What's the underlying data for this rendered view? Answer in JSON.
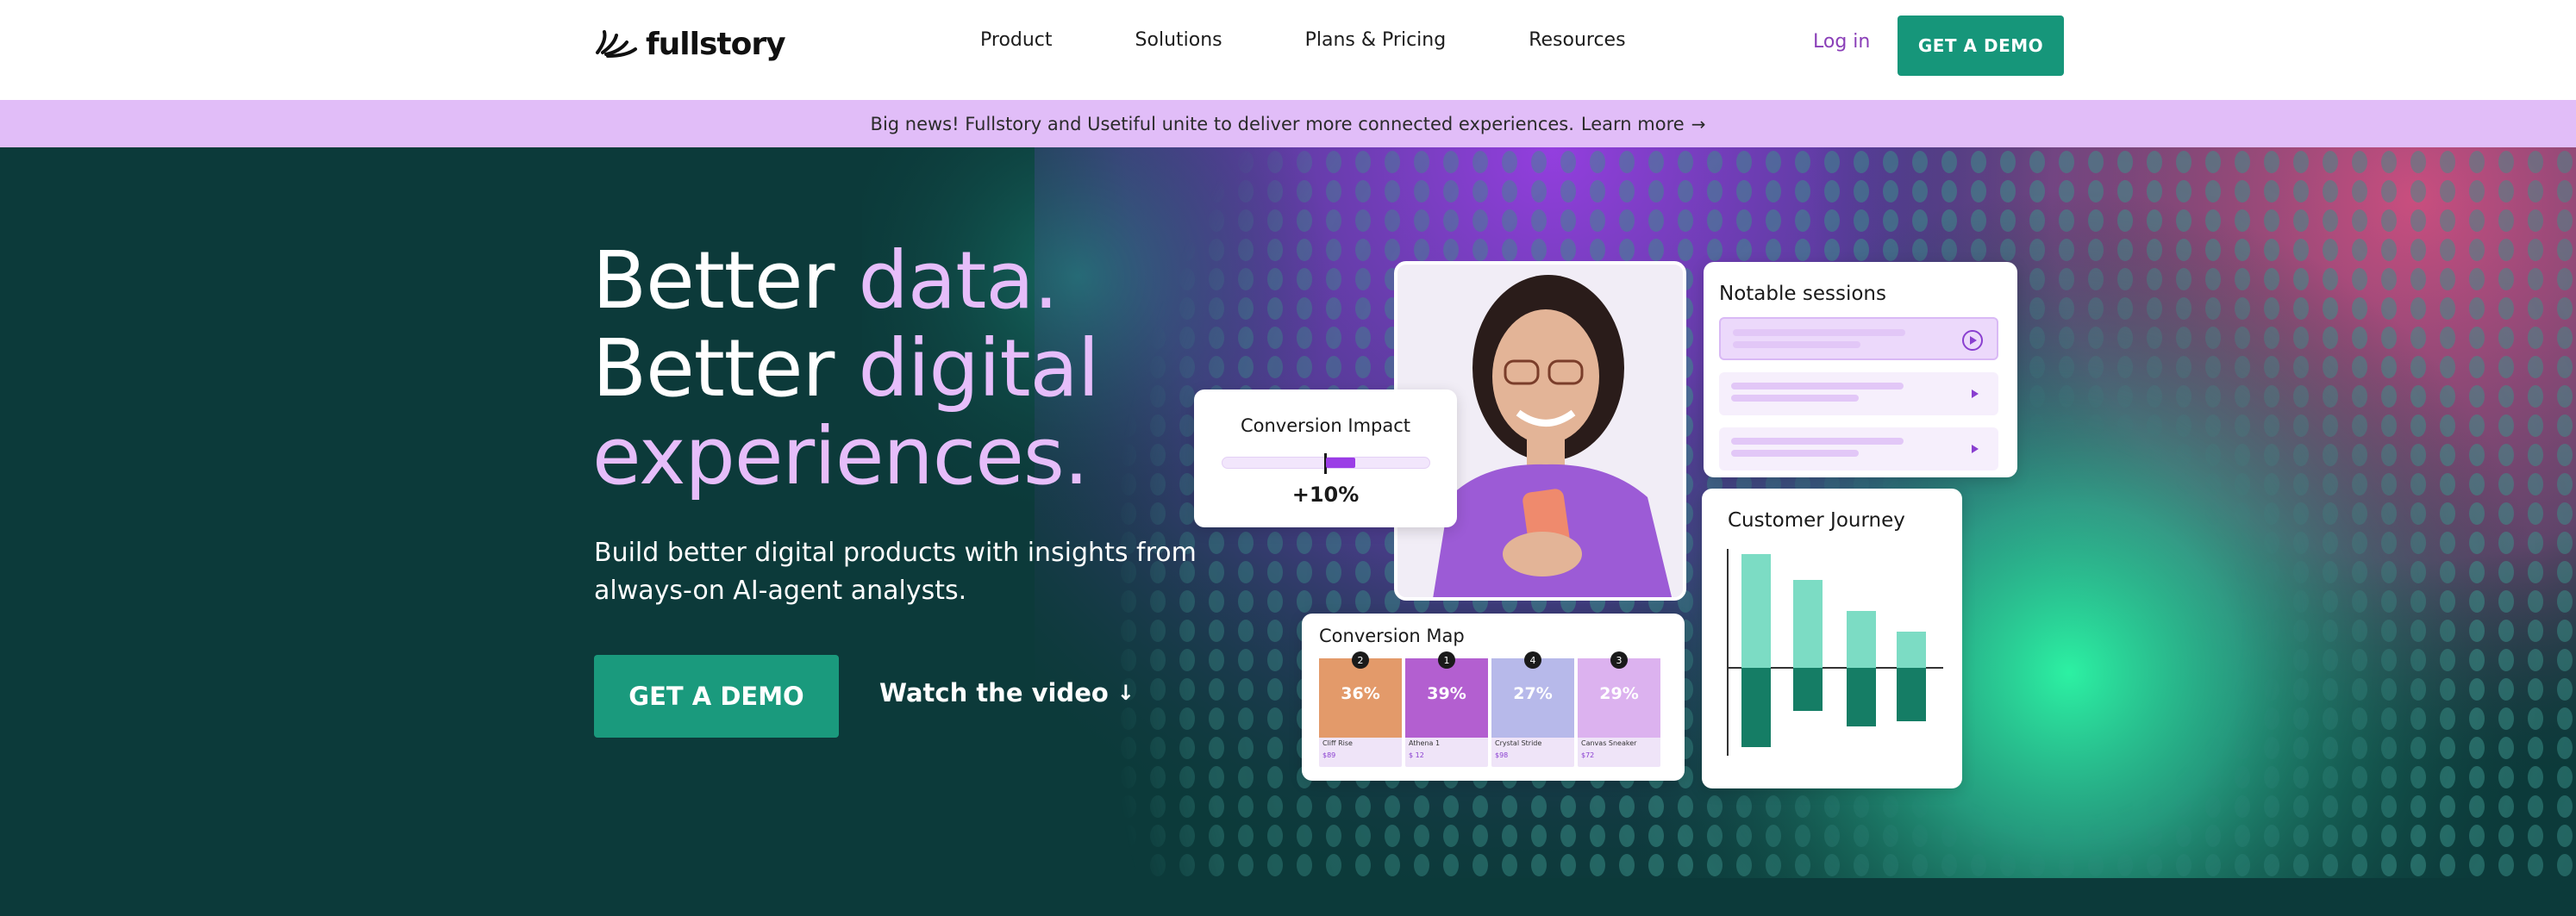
{
  "nav": {
    "brand": "fullstory",
    "links": [
      "Product",
      "Solutions",
      "Plans & Pricing",
      "Resources"
    ],
    "login": "Log in",
    "cta": "GET A DEMO"
  },
  "banner": {
    "text": "Big news! Fullstory and Usetiful unite to deliver more connected experiences.",
    "link": "Learn more",
    "arrow": "→"
  },
  "hero": {
    "headline_line1_a": "Better ",
    "headline_line1_b": "data.",
    "headline_line2_a": "Better ",
    "headline_line2_b": "digital",
    "headline_line3": "experiences.",
    "subhead": "Build better digital products with insights from always-on AI-agent analysts.",
    "cta": "GET A DEMO",
    "watch": "Watch the video",
    "watch_arrow": "↓"
  },
  "cards": {
    "conversion_impact": {
      "title": "Conversion Impact",
      "value": "+10%",
      "fill_fraction": 0.1
    },
    "notable_sessions": {
      "title": "Notable sessions"
    },
    "customer_journey": {
      "title": "Customer Journey"
    },
    "conversion_map": {
      "title": "Conversion Map",
      "tiles": [
        {
          "rank": "2",
          "pct": "36%",
          "name": "Cliff Rise",
          "price": "$89",
          "color": "#e39a6a"
        },
        {
          "rank": "1",
          "pct": "39%",
          "name": "Athena 1",
          "price": "$ 12",
          "color": "#b35fd0"
        },
        {
          "rank": "4",
          "pct": "27%",
          "name": "Crystal Stride",
          "price": "$98",
          "color": "#b7b9ea"
        },
        {
          "rank": "3",
          "pct": "29%",
          "name": "Canvas Sneaker",
          "price": "$72",
          "color": "#dcb2ef"
        }
      ]
    }
  },
  "colors": {
    "brand_green": "#16967a",
    "banner_purple": "#e1bdf8",
    "hero_bg": "#0c3a3a",
    "headline_accent": "#e6bdfa",
    "login_purple": "#8a3fb8"
  }
}
